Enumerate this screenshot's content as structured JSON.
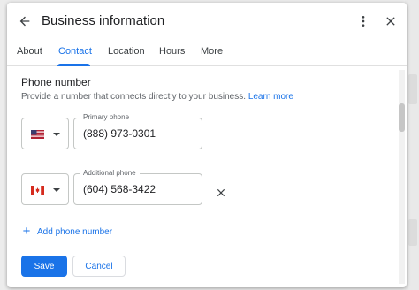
{
  "header": {
    "title": "Business information",
    "back_icon": "arrow-back-icon",
    "more_icon": "more-vert-icon",
    "close_icon": "close-icon"
  },
  "tabs": [
    {
      "label": "About",
      "active": false
    },
    {
      "label": "Contact",
      "active": true
    },
    {
      "label": "Location",
      "active": false
    },
    {
      "label": "Hours",
      "active": false
    },
    {
      "label": "More",
      "active": false
    }
  ],
  "phone_section": {
    "title": "Phone number",
    "description": "Provide a number that connects directly to your business.",
    "learn_more": "Learn more"
  },
  "primary_phone": {
    "country_flag": "us-flag-icon",
    "label": "Primary phone",
    "value": "(888) 973-0301"
  },
  "additional_phone": {
    "country_flag": "canada-flag-icon",
    "label": "Additional phone",
    "value": "(604) 568-3422"
  },
  "add_phone": {
    "label": "Add phone number",
    "icon": "plus-icon"
  },
  "actions": {
    "save": "Save",
    "cancel": "Cancel"
  },
  "colors": {
    "accent": "#1a73e8",
    "text_primary": "#202124",
    "text_secondary": "#5f6368",
    "border": "#c4c7c5"
  }
}
